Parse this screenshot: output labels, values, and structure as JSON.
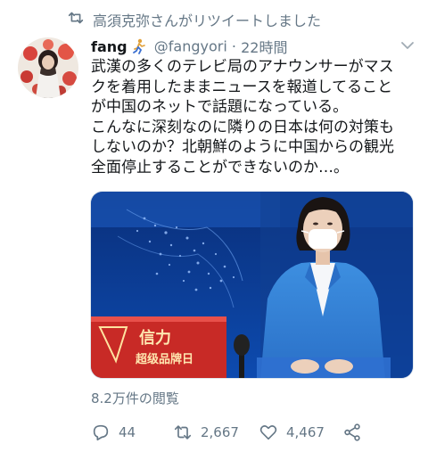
{
  "retweet_context": {
    "text": "高須克弥さんがリツイートしました",
    "icon": "retweet-icon"
  },
  "author": {
    "display_name": "fang",
    "name_emoji": "runner-emoji",
    "handle": "@fangyori",
    "separator": "·",
    "timestamp": "22時間"
  },
  "tweet": {
    "lines": [
      "武漢の多くのテレビ局のアナウンサーがマス",
      "クを着用したままニュースを報道してること",
      "が中国のネットで話題になっている。",
      "こんなに深刻なのに隣りの日本は何の対策も",
      "しないのか？北朝鮮のように中国からの観光",
      "全面停止することができないのか…。"
    ]
  },
  "media": {
    "desk_text_1": "信力",
    "desk_text_2": "超级品牌日"
  },
  "stats": {
    "views": "8.2万件の閲覧"
  },
  "actions": {
    "replies": "44",
    "retweets": "2,667",
    "likes": "4,467"
  },
  "colors": {
    "text": "#14171a",
    "secondary": "#657786",
    "studio_blue": "#1a4fa8",
    "desk_red": "#d0322c"
  }
}
